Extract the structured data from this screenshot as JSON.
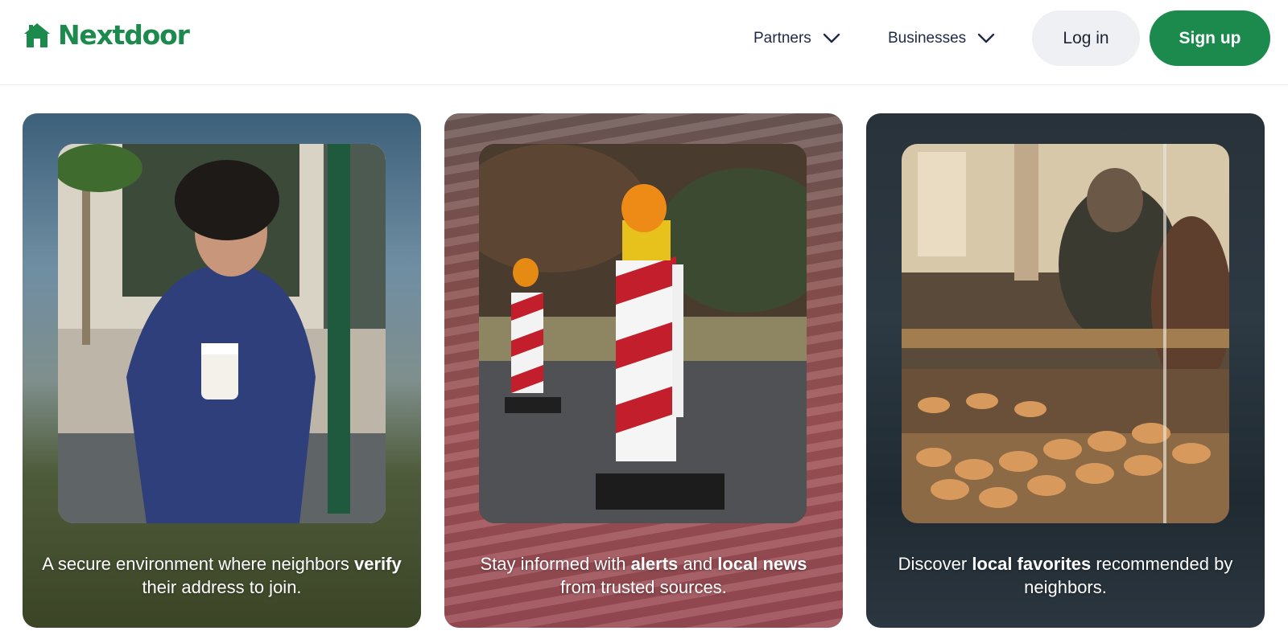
{
  "header": {
    "logo_text": "Nextdoor",
    "nav": {
      "partners_label": "Partners",
      "businesses_label": "Businesses"
    },
    "login_label": "Log in",
    "signup_label": "Sign up"
  },
  "cards": [
    {
      "caption_parts": [
        "A secure environment where neighbors ",
        "verify",
        " their address to join."
      ]
    },
    {
      "caption_parts": [
        "Stay informed with ",
        "alerts",
        " and ",
        "local news",
        " from trusted sources."
      ]
    },
    {
      "caption_parts": [
        "Discover ",
        "local favorites",
        " recommended by neighbors."
      ]
    }
  ],
  "colors": {
    "brand_green": "#1b8a4c",
    "login_bg": "#eef0f3"
  }
}
